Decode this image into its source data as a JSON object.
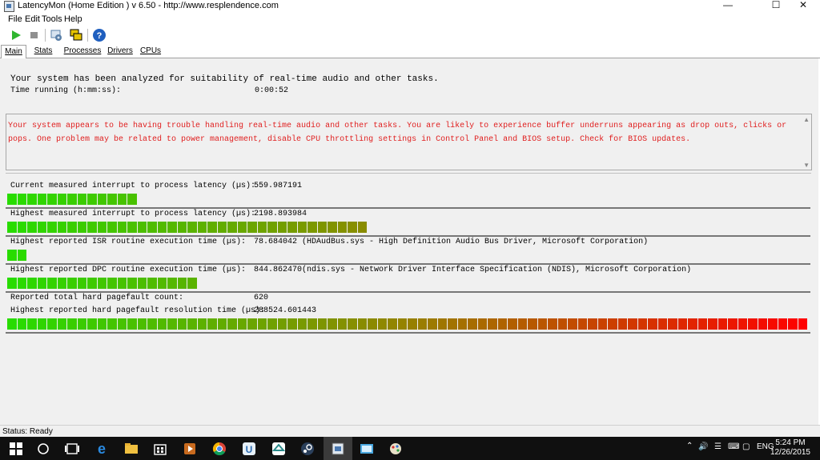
{
  "window": {
    "title": "LatencyMon  (Home Edition )  v 6.50 - http://www.resplendence.com",
    "minimize_glyph": "—",
    "maximize_glyph": "☐",
    "close_glyph": "✕"
  },
  "menu": [
    "File",
    "Edit",
    "Tools",
    "Help"
  ],
  "toolbar": {
    "buttons": [
      {
        "name": "play-icon",
        "color": "#2fb52f"
      },
      {
        "name": "stop-icon",
        "color": "#909090"
      },
      {
        "name": "gear-icon",
        "color": "#5a7fa8"
      },
      {
        "name": "windows-icon",
        "color": "#e6c400"
      },
      {
        "name": "help-icon",
        "color": "#1f5fbf"
      }
    ]
  },
  "tabs": [
    "Main",
    "Stats",
    "Processes",
    "Drivers",
    "CPUs"
  ],
  "main": {
    "analyzed_text": "Your system has been analyzed for suitability of real-time audio and other tasks.",
    "time_running_label": "Time running (h:mm:ss):",
    "time_running_value": "0:00:52",
    "warning": "Your system appears to be having trouble handling real-time audio and other tasks. You are likely to experience buffer underruns appearing as drop outs, clicks or pops. One problem may be related to power management, disable CPU throttling settings in Control Panel and BIOS setup. Check for BIOS updates.",
    "metrics": [
      {
        "label": "Current measured interrupt to process latency (µs):",
        "value": "559.987191",
        "extra": "",
        "fill": 0.165
      },
      {
        "label": "Highest measured interrupt to process latency (µs):",
        "value": "2198.893984",
        "extra": "",
        "fill": 0.455
      },
      {
        "label": "Highest reported ISR routine execution time (µs):",
        "value": "78.684042",
        "extra": "(HDAudBus.sys - High Definition Audio Bus Driver, Microsoft Corporation)",
        "fill": 0.024
      },
      {
        "label": "Highest reported DPC routine execution time (µs):",
        "value": "844.862470",
        "extra": "(ndis.sys - Network Driver Interface Specification (NDIS), Microsoft Corporation)",
        "fill": 0.24
      }
    ],
    "pagefault_count_label": "Reported total hard pagefault count:",
    "pagefault_count_value": "620",
    "pagefault_time_label": "Highest reported hard pagefault resolution time (µs):",
    "pagefault_time_value": "288524.601443",
    "pagefault_fill": 1.0
  },
  "status": "Status: Ready",
  "taskbar": {
    "lang": "ENG",
    "time": "5:24 PM",
    "date": "12/26/2015"
  }
}
